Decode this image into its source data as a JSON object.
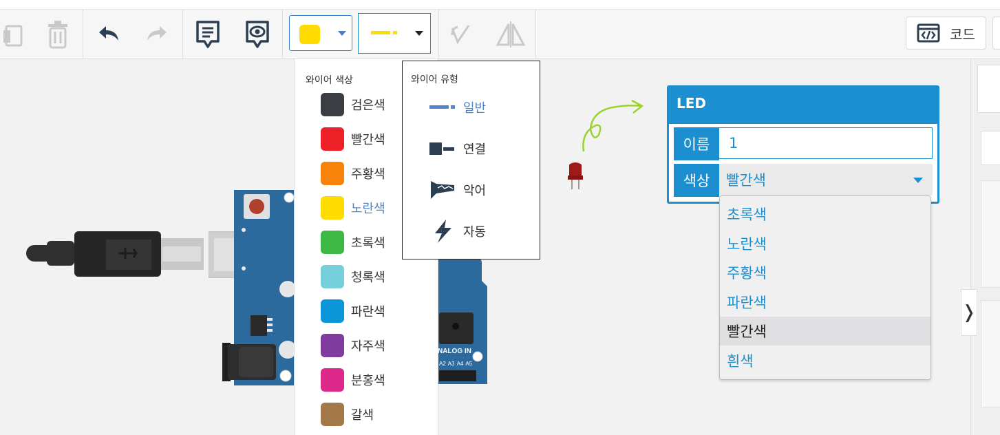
{
  "toolbar": {
    "code_label": "코드",
    "selected_wire_color": "#ffdc00",
    "selected_wire_type_color": "#ffdc00"
  },
  "wire_color_menu": {
    "title": "와이어 색상",
    "items": [
      {
        "label": "검은색",
        "color": "#3a3d41",
        "active": false
      },
      {
        "label": "빨간색",
        "color": "#ed2027",
        "active": false
      },
      {
        "label": "주황색",
        "color": "#f7830b",
        "active": false
      },
      {
        "label": "노란색",
        "color": "#ffdc00",
        "active": true
      },
      {
        "label": "초록색",
        "color": "#3dba46",
        "active": false
      },
      {
        "label": "청록색",
        "color": "#76d0dc",
        "active": false
      },
      {
        "label": "파란색",
        "color": "#0b96da",
        "active": false
      },
      {
        "label": "자주색",
        "color": "#7f3b9e",
        "active": false
      },
      {
        "label": "분홍색",
        "color": "#dd2a8a",
        "active": false
      },
      {
        "label": "갈색",
        "color": "#a5784a",
        "active": false
      }
    ]
  },
  "wire_type_menu": {
    "title": "와이어 유형",
    "items": [
      {
        "label": "일반",
        "icon": "normal-wire-icon",
        "active": true
      },
      {
        "label": "연결",
        "icon": "connector-wire-icon",
        "active": false
      },
      {
        "label": "악어",
        "icon": "alligator-clip-icon",
        "active": false
      },
      {
        "label": "자동",
        "icon": "auto-wire-icon",
        "active": false
      }
    ]
  },
  "led_inspector": {
    "title": "LED",
    "name_label": "이름",
    "name_value": "1",
    "color_label": "색상",
    "color_value": "빨간색",
    "options": [
      "초록색",
      "노란색",
      "주황색",
      "파란색",
      "빨간색",
      "흰색"
    ],
    "selected_option": "빨간색"
  },
  "board": {
    "analog_label": "NALOG IN",
    "pins": [
      "A2",
      "A3",
      "A4",
      "A5"
    ]
  },
  "colors": {
    "accent": "#1b8fd0",
    "board_blue": "#2c6a9e"
  }
}
